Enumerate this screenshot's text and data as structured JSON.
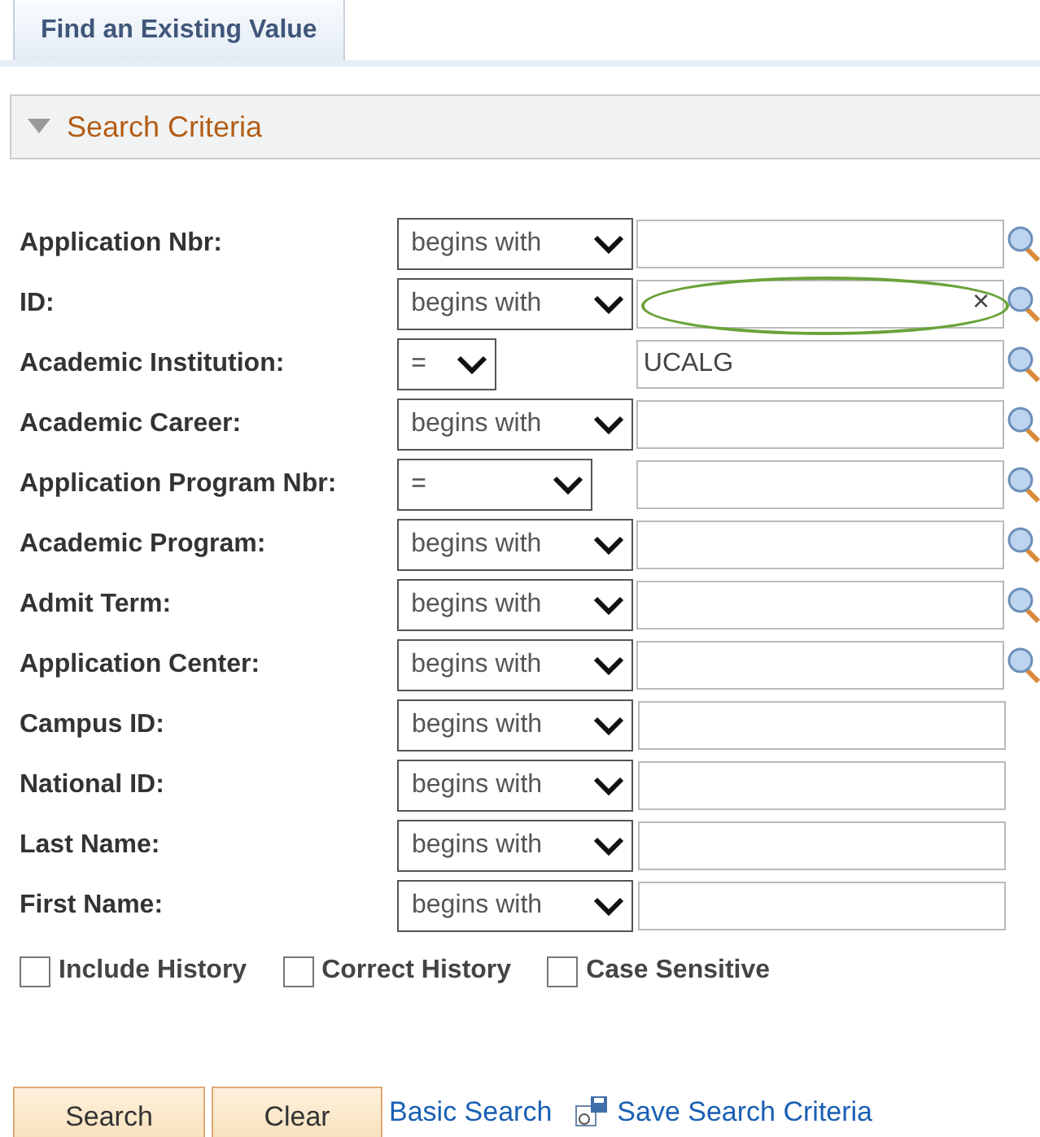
{
  "tabs": [
    {
      "label": "Find an Existing Value",
      "selected": true
    }
  ],
  "section": {
    "title": "Search Criteria",
    "expanded": true
  },
  "fields": [
    {
      "label": "Application Nbr:",
      "operator": "begins with",
      "kind": "wide",
      "lookup": true
    },
    {
      "label": "ID:",
      "operator": "begins with",
      "kind": "wide",
      "lookup": true,
      "highlighted": true,
      "clear_icon": "×"
    },
    {
      "label": "Academic Institution:",
      "operator": "=",
      "kind": "narrow",
      "value": "UCALG",
      "lookup": true
    },
    {
      "label": "Academic Career:",
      "operator": "begins with",
      "kind": "wide",
      "lookup": true
    },
    {
      "label": "Application Program Nbr:",
      "operator": "=",
      "kind": "medium",
      "lookup": true
    },
    {
      "label": "Academic Program:",
      "operator": "begins with",
      "kind": "wide",
      "lookup": true
    },
    {
      "label": "Admit Term:",
      "operator": "begins with",
      "kind": "wide",
      "lookup": true
    },
    {
      "label": "Application Center:",
      "operator": "begins with",
      "kind": "wide",
      "lookup": true
    },
    {
      "label": "Campus ID:",
      "operator": "begins with",
      "kind": "wide",
      "lookup": false
    },
    {
      "label": "National ID:",
      "operator": "begins with",
      "kind": "wide",
      "lookup": false
    },
    {
      "label": "Last Name:",
      "operator": "begins with",
      "kind": "wide",
      "lookup": false
    },
    {
      "label": "First Name:",
      "operator": "begins with",
      "kind": "wide",
      "lookup": false
    }
  ],
  "options": [
    {
      "label": "Include History",
      "checked": false
    },
    {
      "label": "Correct History",
      "checked": false
    },
    {
      "label": "Case Sensitive",
      "checked": false
    }
  ],
  "buttons": [
    {
      "label": "Search"
    },
    {
      "label": "Clear"
    }
  ],
  "links": [
    {
      "label": "Basic Search",
      "icon": false
    },
    {
      "label": "Save Search Criteria",
      "icon": true
    }
  ]
}
